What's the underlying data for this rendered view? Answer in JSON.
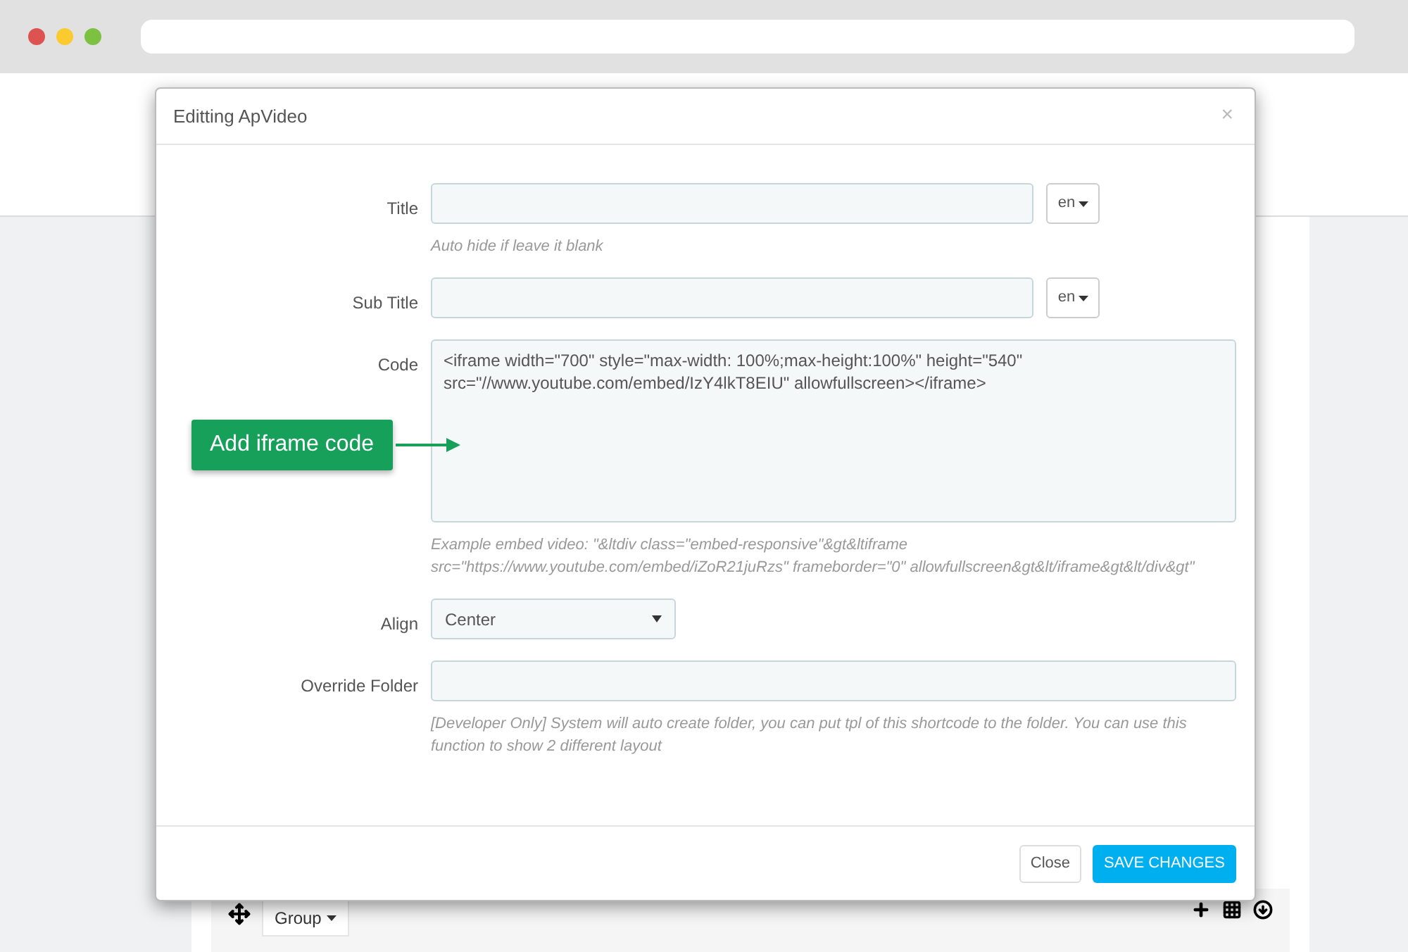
{
  "modal": {
    "title": "Editting ApVideo",
    "close": "×",
    "fields": [
      {
        "kind": "text",
        "label": "Title",
        "lang": "en",
        "help": "Auto hide if leave it blank"
      },
      {
        "kind": "text",
        "label": "Sub Title",
        "lang": "en"
      },
      {
        "kind": "textarea",
        "label": "Code",
        "value": "<iframe width=\"700\" style=\"max-width: 100%;max-height:100%\"  height=\"540\" src=\"//www.youtube.com/embed/IzY4lkT8EIU\" allowfullscreen></iframe>",
        "help": "Example embed video: \"&ltdiv class=\"embed-responsive\"&gt&ltiframe src=\"https://www.youtube.com/embed/iZoR21juRzs\" frameborder=\"0\" allowfullscreen&gt&lt/iframe&gt&lt/div&gt\""
      },
      {
        "kind": "select",
        "label": "Align",
        "value": "Center"
      },
      {
        "kind": "text",
        "label": "Override Folder",
        "help": "[Developer Only] System will auto create folder, you can put tpl of this shortcode to the folder. You can use this function to show 2 different layout"
      }
    ],
    "buttons": [
      {
        "label": "Close",
        "kind": "default"
      },
      {
        "label": "SAVE CHANGES",
        "kind": "primary"
      }
    ]
  },
  "callout": {
    "text": "Add iframe code"
  },
  "toolbar": {
    "group": "Group"
  }
}
